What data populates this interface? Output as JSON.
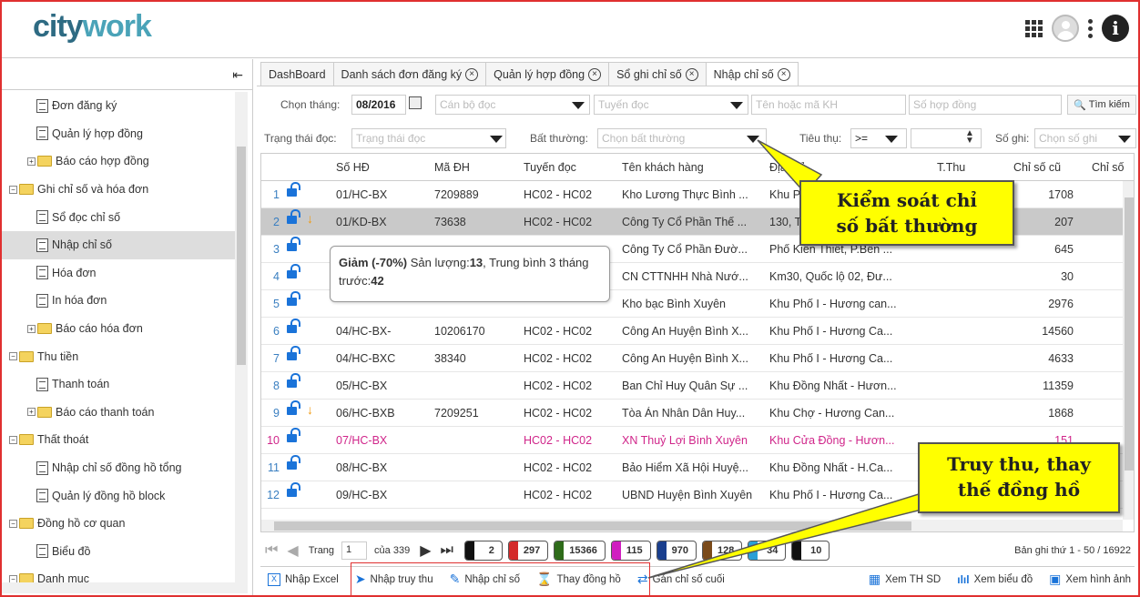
{
  "app": {
    "logo_part1": "city",
    "logo_part2": "work"
  },
  "sidebar": {
    "items": [
      {
        "label": "Đơn đăng ký",
        "type": "doc",
        "indent": 1
      },
      {
        "label": "Quản lý hợp đồng",
        "type": "doc",
        "indent": 1
      },
      {
        "label": "Báo cáo hợp đồng",
        "type": "folder-collapsed",
        "indent": 1
      },
      {
        "label": "Ghi chỉ số và hóa đơn",
        "type": "folder-expanded",
        "indent": 0
      },
      {
        "label": "Sổ đọc chỉ số",
        "type": "doc",
        "indent": 1
      },
      {
        "label": "Nhập chỉ số",
        "type": "doc",
        "indent": 1,
        "selected": true
      },
      {
        "label": "Hóa đơn",
        "type": "doc",
        "indent": 1
      },
      {
        "label": "In hóa đơn",
        "type": "doc",
        "indent": 1
      },
      {
        "label": "Báo cáo hóa đơn",
        "type": "folder-collapsed",
        "indent": 1
      },
      {
        "label": "Thu tiền",
        "type": "folder-expanded",
        "indent": 0
      },
      {
        "label": "Thanh toán",
        "type": "doc",
        "indent": 1
      },
      {
        "label": "Báo cáo thanh toán",
        "type": "folder-collapsed",
        "indent": 1
      },
      {
        "label": "Thất thoát",
        "type": "folder-expanded",
        "indent": 0
      },
      {
        "label": "Nhập chỉ số đồng hồ tổng",
        "type": "doc",
        "indent": 1
      },
      {
        "label": "Quản lý đồng hồ block",
        "type": "doc",
        "indent": 1
      },
      {
        "label": "Đồng hồ cơ quan",
        "type": "folder-expanded",
        "indent": 0
      },
      {
        "label": "Biểu đồ",
        "type": "doc",
        "indent": 1
      },
      {
        "label": "Danh mục",
        "type": "folder-expanded",
        "indent": 0
      }
    ]
  },
  "tabs": [
    {
      "label": "DashBoard",
      "closable": false
    },
    {
      "label": "Danh sách đơn đăng ký",
      "closable": true
    },
    {
      "label": "Quản lý hợp đồng",
      "closable": true
    },
    {
      "label": "Sổ ghi chỉ số",
      "closable": true
    },
    {
      "label": "Nhập chỉ số",
      "closable": true,
      "active": true
    }
  ],
  "filters": {
    "month_label": "Chọn tháng:",
    "month_value": "08/2016",
    "reader_ph": "Cán bộ đọc",
    "route_ph": "Tuyến đọc",
    "customer_ph": "Tên hoặc mã KH",
    "contract_ph": "Số hợp đồng",
    "search_btn": "Tìm kiếm",
    "status_label": "Trạng thái đọc:",
    "status_ph": "Trạng thái đọc",
    "abnormal_label": "Bất thường:",
    "abnormal_ph": "Chọn bất thường",
    "usage_label": "Tiêu thụ:",
    "usage_op": ">=",
    "record_label": "Số ghi:",
    "record_ph": "Chọn số ghi"
  },
  "table": {
    "columns": {
      "so_hd": "Số HĐ",
      "ma_dh": "Mã ĐH",
      "tuyen": "Tuyến đọc",
      "ten": "Tên khách hàng",
      "dia_chi": "Địa chỉ",
      "tthu": "T.Thu",
      "cu": "Chỉ số cũ",
      "moi": "Chỉ số"
    },
    "rows": [
      {
        "n": "1",
        "so_hd": "01/HC-BX",
        "ma_dh": "7209889",
        "tuyen": "HC02 - HC02",
        "ten": "Kho Lương Thực Bình ...",
        "dia_chi": "Khu P",
        "cu": "1708",
        "arrow": false
      },
      {
        "n": "2",
        "so_hd": "01/KD-BX",
        "ma_dh": "73638",
        "tuyen": "HC02 - HC02",
        "ten": "Công Ty Cổ Phần Thế ...",
        "dia_chi": "130, T",
        "cu": "207",
        "arrow": true,
        "selected": true
      },
      {
        "n": "3",
        "so_hd": "",
        "ma_dh": "",
        "tuyen": "",
        "ten": "Công Ty Cổ Phần Đườ...",
        "dia_chi": "Phố Kiến Thiết, P.Bến ...",
        "cu": "645",
        "arrow": false
      },
      {
        "n": "4",
        "so_hd": "",
        "ma_dh": "",
        "tuyen": "",
        "ten": "CN CTTNHH Nhà Nướ...",
        "dia_chi": "Km30, Quốc lộ 02, Đư...",
        "cu": "30",
        "arrow": false
      },
      {
        "n": "5",
        "so_hd": "",
        "ma_dh": "",
        "tuyen": "",
        "ten": "Kho bạc Bình Xuyên",
        "dia_chi": "Khu Phố I - Hương can...",
        "cu": "2976",
        "arrow": false
      },
      {
        "n": "6",
        "so_hd": "04/HC-BX-",
        "ma_dh": "10206170",
        "tuyen": "HC02 - HC02",
        "ten": "Công An Huyện Bình X...",
        "dia_chi": "Khu Phố I - Hương Ca...",
        "cu": "14560",
        "arrow": false
      },
      {
        "n": "7",
        "so_hd": "04/HC-BXC",
        "ma_dh": "38340",
        "tuyen": "HC02 - HC02",
        "ten": "Công An Huyện Bình X...",
        "dia_chi": "Khu Phố I - Hương Ca...",
        "cu": "4633",
        "arrow": false
      },
      {
        "n": "8",
        "so_hd": "05/HC-BX",
        "ma_dh": "",
        "tuyen": "HC02 - HC02",
        "ten": "Ban Chỉ Huy Quân Sự ...",
        "dia_chi": "Khu Đồng Nhất - Hươn...",
        "cu": "11359",
        "arrow": false
      },
      {
        "n": "9",
        "so_hd": "06/HC-BXB",
        "ma_dh": "7209251",
        "tuyen": "HC02 - HC02",
        "ten": "Tòa Án Nhân Dân Huy...",
        "dia_chi": "Khu Chợ - Hương Can...",
        "cu": "1868",
        "arrow": true
      },
      {
        "n": "10",
        "so_hd": "07/HC-BX",
        "ma_dh": "",
        "tuyen": "HC02 - HC02",
        "ten": "XN Thuỷ Lợi Bình Xuyên",
        "dia_chi": "Khu Cửa Đồng - Hươn...",
        "cu": "151",
        "arrow": false,
        "pink": true
      },
      {
        "n": "11",
        "so_hd": "08/HC-BX",
        "ma_dh": "",
        "tuyen": "HC02 - HC02",
        "ten": "Bảo Hiểm Xã Hội Huyệ...",
        "dia_chi": "Khu Đồng Nhất - H.Ca...",
        "cu": "",
        "arrow": false
      },
      {
        "n": "12",
        "so_hd": "09/HC-BX",
        "ma_dh": "",
        "tuyen": "HC02 - HC02",
        "ten": "UBND Huyện Bình Xuyên",
        "dia_chi": "Khu Phố I - Hương Ca...",
        "cu": "",
        "arrow": false
      }
    ]
  },
  "tooltip": {
    "part1": "Giảm (-70%)",
    "part2": " Sản lượng:",
    "part3": "13",
    "part4": ", Trung bình 3 tháng trước:",
    "part5": "42"
  },
  "pager": {
    "page_label": "Trang",
    "page_value": "1",
    "of_label": "của 339",
    "counts": [
      {
        "value": "2",
        "color": "#111111"
      },
      {
        "value": "297",
        "color": "#d42a2a"
      },
      {
        "value": "15366",
        "color": "#2e6b1a"
      },
      {
        "value": "115",
        "color": "#d01ec0"
      },
      {
        "value": "970",
        "color": "#1a3f8e"
      },
      {
        "value": "128",
        "color": "#7a4a1a"
      },
      {
        "value": "34",
        "color": "#2a9fd6"
      },
      {
        "value": "10",
        "color": "#111111"
      }
    ],
    "record_info": "Bản ghi thứ 1 - 50 / 16922"
  },
  "toolbar": {
    "export_excel": "Nhập Excel",
    "import_arrears": "Nhập truy thu",
    "enter_index": "Nhập chỉ số",
    "replace_meter": "Thay đồng hồ",
    "assign_last": "Gán chỉ số cuối",
    "view_th": "Xem TH SD",
    "view_chart": "Xem biểu đồ",
    "view_image": "Xem hình ảnh"
  },
  "callouts": {
    "abnormal_line1": "Kiểm soát chỉ",
    "abnormal_line2": "số bất thường",
    "arrears_line1": "Truy thu, thay",
    "arrears_line2": "thế đồng hồ"
  }
}
